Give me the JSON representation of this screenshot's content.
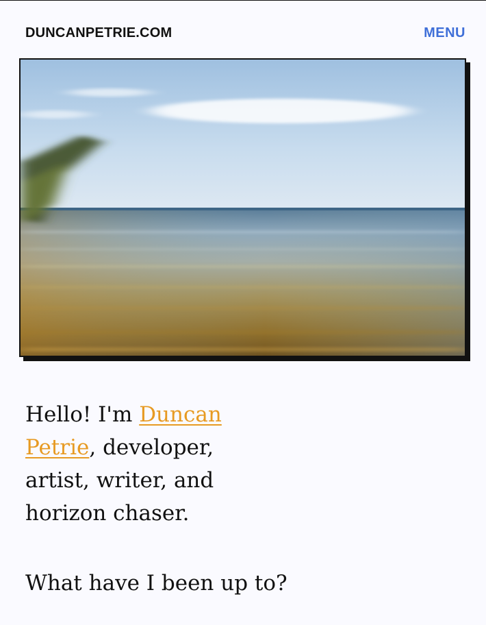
{
  "header": {
    "site_title": "DUNCANPETRIE.COM",
    "menu_label": "MENU"
  },
  "hero": {
    "alt": "Blurred seascape with horizon, blue sky and golden shallows"
  },
  "intro": {
    "greeting": "Hello! I'm ",
    "name_link": "Duncan Petrie",
    "rest": ", developer, artist, writer, and horizon chaser."
  },
  "section": {
    "heading": "What have I been up to?"
  },
  "colors": {
    "accent_link": "#e79a22",
    "menu_blue": "#3f6fd8",
    "background": "#fafaff",
    "text": "#111111"
  }
}
